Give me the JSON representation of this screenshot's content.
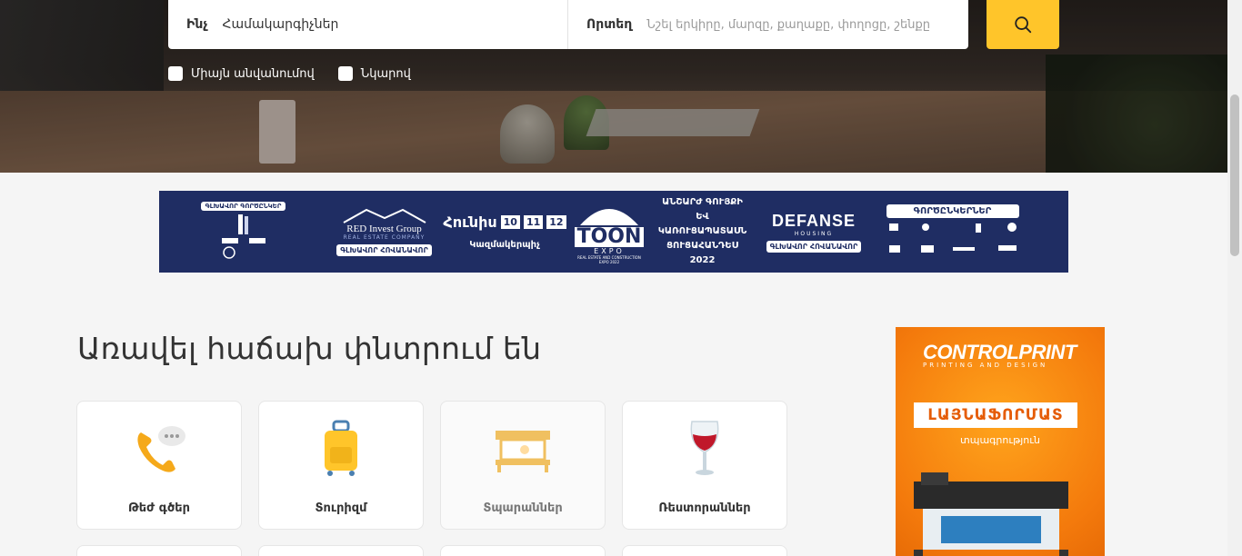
{
  "search": {
    "what_label": "Ինչ",
    "what_value": "Համակարգիչներ",
    "where_label": "Որտեղ",
    "where_placeholder": "Նշել երկիրը, մարզը, քաղաքը, փողոցը, շենքը"
  },
  "filters": [
    {
      "label": "Միայն անվանումով",
      "checked": false
    },
    {
      "label": "Նկարով",
      "checked": false
    }
  ],
  "banner": {
    "partners_title": "ԳԼԽԱՎՈՐ ԳՈՐԾԸՆԿԵՐ",
    "red_invest_name": "RED Invest Group",
    "red_invest_sub": "REAL ESTATE COMPANY",
    "main_sponsor": "ԳԼԽԱՎՈՐ ՀՈՎԱՆԱՎՈՐ",
    "month": "Հունիս",
    "days": [
      "10",
      "11",
      "12"
    ],
    "organizer_text": "Կազմակերպիչ",
    "expo_name": "TOON",
    "expo_word": "EXPO",
    "expo_sub": "REAL ESTATE AND CONSTRUCTION EXPO 2022",
    "exhibition_text": "ԱՆՇԱՐԺ ԳՈՒՅՔԻ ԵՎ ԿԱՌՈՒՑԱՊԱՏԱՍՆ ՑՈՒՑԱՀԱՆԴԵՍ 2022",
    "defanse_name": "DEFANSE",
    "defanse_sub": "HOUSING",
    "defanse_role": "ԳԼԽԱՎՈՐ ՀՈՎԱՆԱՎՈՐ",
    "partners_label": "ԳՈՐԾԸՆԿԵՐՆԵՐ"
  },
  "section": {
    "title": "Առավել հաճախ փնտրում են"
  },
  "categories": [
    {
      "label": "Թեժ գծեր",
      "icon": "phone-chat-icon"
    },
    {
      "label": "Տուրիզմ",
      "icon": "suitcase-icon"
    },
    {
      "label": "Տպարաններ",
      "icon": "printer-icon"
    },
    {
      "label": "Ռեստորաններ",
      "icon": "wine-glass-icon"
    }
  ],
  "ad": {
    "brand": "CONTROLPRINT",
    "tagline": "PRINTING AND DESIGN",
    "button": "ԼԱՅՆԱՖՈՐՄԱՏ",
    "text": "տպագրություն"
  },
  "colors": {
    "accent": "#ffc52a",
    "banner_bg": "#1f2d63",
    "ad_orange": "#f47a0c"
  }
}
